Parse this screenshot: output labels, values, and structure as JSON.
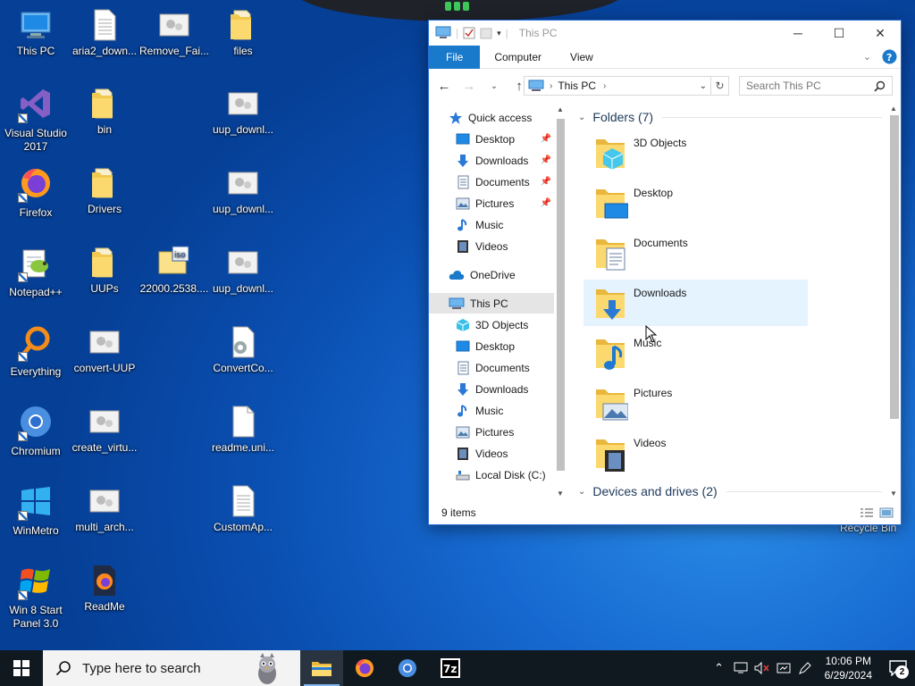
{
  "desktop": {
    "icons": [
      {
        "label": "This PC"
      },
      {
        "label": "aria2_down..."
      },
      {
        "label": "Remove_Fai..."
      },
      {
        "label": "files"
      },
      {
        "label": "Visual Studio 2017"
      },
      {
        "label": "bin"
      },
      {
        "label": "uup_downl..."
      },
      {
        "label": "Firefox"
      },
      {
        "label": "Drivers"
      },
      {
        "label": "uup_downl..."
      },
      {
        "label": "Notepad++"
      },
      {
        "label": "UUPs"
      },
      {
        "label": "22000.2538...."
      },
      {
        "label": "uup_downl..."
      },
      {
        "label": "Everything"
      },
      {
        "label": "convert-UUP"
      },
      {
        "label": "ConvertCo..."
      },
      {
        "label": "Chromium"
      },
      {
        "label": "create_virtu..."
      },
      {
        "label": "readme.uni..."
      },
      {
        "label": "WinMetro"
      },
      {
        "label": "multi_arch..."
      },
      {
        "label": "CustomAp..."
      },
      {
        "label": "Win 8 Start Panel 3.0"
      },
      {
        "label": "ReadMe"
      }
    ],
    "recycle_bin": "Recycle Bin"
  },
  "explorer": {
    "title": "This PC",
    "ribbon_tabs": [
      "File",
      "Computer",
      "View"
    ],
    "address": "This PC",
    "search_placeholder": "Search This PC",
    "nav": {
      "quick_access": "Quick access",
      "qa_items": [
        "Desktop",
        "Downloads",
        "Documents",
        "Pictures",
        "Music",
        "Videos"
      ],
      "onedrive": "OneDrive",
      "this_pc": "This PC",
      "pc_items": [
        "3D Objects",
        "Desktop",
        "Documents",
        "Downloads",
        "Music",
        "Pictures",
        "Videos",
        "Local Disk (C:)"
      ]
    },
    "groups": {
      "folders": "Folders (7)",
      "devices": "Devices and drives (2)"
    },
    "folders": [
      "3D Objects",
      "Desktop",
      "Documents",
      "Downloads",
      "Music",
      "Pictures",
      "Videos"
    ],
    "status": "9 items"
  },
  "taskbar": {
    "search_placeholder": "Type here to search",
    "apps": [
      "file-explorer",
      "firefox",
      "chromium",
      "7zip"
    ],
    "time": "10:06 PM",
    "date": "6/29/2024",
    "notification_count": "2"
  },
  "colors": {
    "accent": "#1979ca",
    "desktop": "#1668cf",
    "taskbar": "#101820"
  }
}
